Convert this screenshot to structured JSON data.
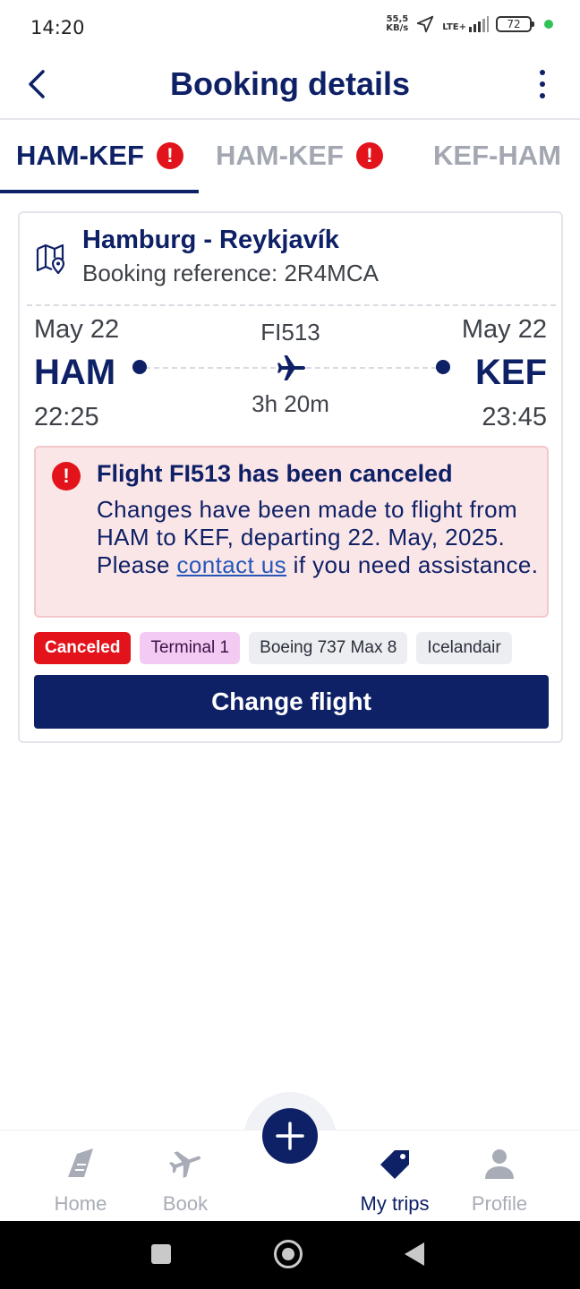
{
  "status_bar": {
    "time": "14:20",
    "net_speed_value": "55,5",
    "net_speed_unit": "KB/s",
    "network": "LTE+",
    "battery": "72"
  },
  "header": {
    "title": "Booking details"
  },
  "tabs": [
    {
      "label": "HAM-KEF",
      "active": true,
      "alert": "!"
    },
    {
      "label": "HAM-KEF",
      "active": false,
      "alert": "!"
    },
    {
      "label": "KEF-HAM",
      "active": false
    }
  ],
  "card": {
    "route": "Hamburg - Reykjavík",
    "booking_reference": "Booking reference: 2R4MCA",
    "flight": {
      "departure_date": "May 22",
      "departure_code": "HAM",
      "departure_time": "22:25",
      "arrival_date": "May 22",
      "arrival_code": "KEF",
      "arrival_time": "23:45",
      "flight_number": "FI513",
      "duration": "3h 20m"
    },
    "alert": {
      "icon": "!",
      "title": "Flight FI513 has been canceled",
      "body_before": "Changes have been made to flight from HAM to KEF, departing 22. May, 2025. Please ",
      "link": "contact us",
      "body_after": " if you need assistance."
    },
    "chips": {
      "status": "Canceled",
      "terminal": "Terminal 1",
      "aircraft": "Boeing 737 Max 8",
      "airline": "Icelandair"
    },
    "change_button": "Change flight"
  },
  "bottom_nav": {
    "home": "Home",
    "book": "Book",
    "my_trips": "My trips",
    "profile": "Profile",
    "active": "my_trips"
  },
  "colors": {
    "brand": "#0e2066",
    "alert_red": "#e3131c",
    "alert_bg": "#fbe6e7",
    "terminal_chip": "#f3cbf2",
    "link": "#2457b8"
  },
  "icons": {
    "back": "chevron-left-icon",
    "more": "more-vertical-icon",
    "route": "map-pin-icon",
    "flight": "airplane-icon",
    "fab": "plus-icon"
  }
}
